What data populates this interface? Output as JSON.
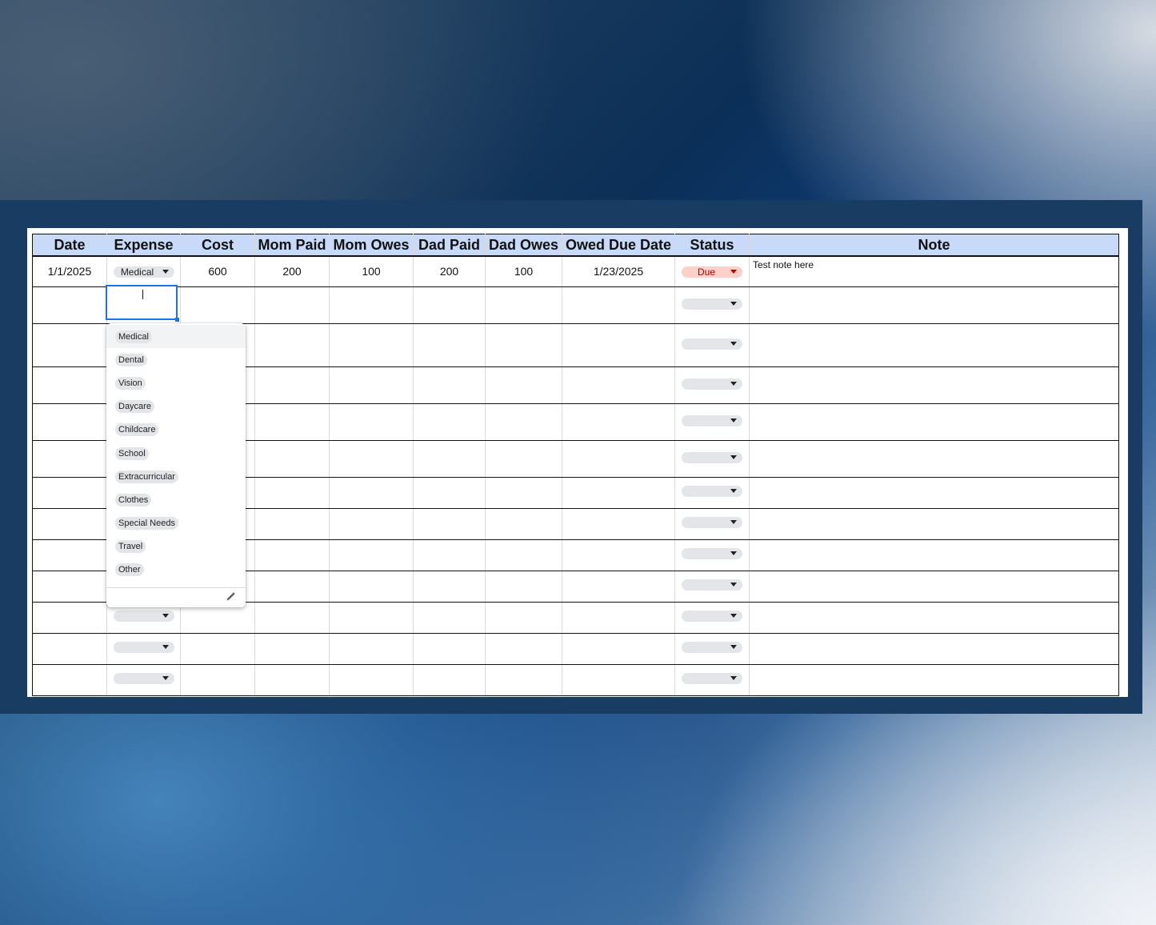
{
  "table": {
    "headers": [
      "Date",
      "Expense",
      "Cost",
      "Mom Paid",
      "Mom Owes",
      "Dad Paid",
      "Dad Owes",
      "Owed Due Date",
      "Status",
      "Note"
    ],
    "row1": {
      "date": "1/1/2025",
      "expense": "Medical",
      "cost": "600",
      "mom_paid": "200",
      "mom_owes": "100",
      "dad_paid": "200",
      "dad_owes": "100",
      "owed_due_date": "1/23/2025",
      "status": "Due",
      "note": "Test note here"
    }
  },
  "expense_dropdown": {
    "options": [
      "Medical",
      "Dental",
      "Vision",
      "Daycare",
      "Childcare",
      "School",
      "Extracurricular",
      "Clothes",
      "Special Needs",
      "Travel",
      "Other"
    ],
    "edit_icon": "pencil-icon"
  },
  "colors": {
    "header_bg": "#c9daf8",
    "frame_bg": "#193c63",
    "owes_text": "#e8000b",
    "status_due_bg": "#ffcfc9",
    "active_border": "#1a73e8"
  }
}
